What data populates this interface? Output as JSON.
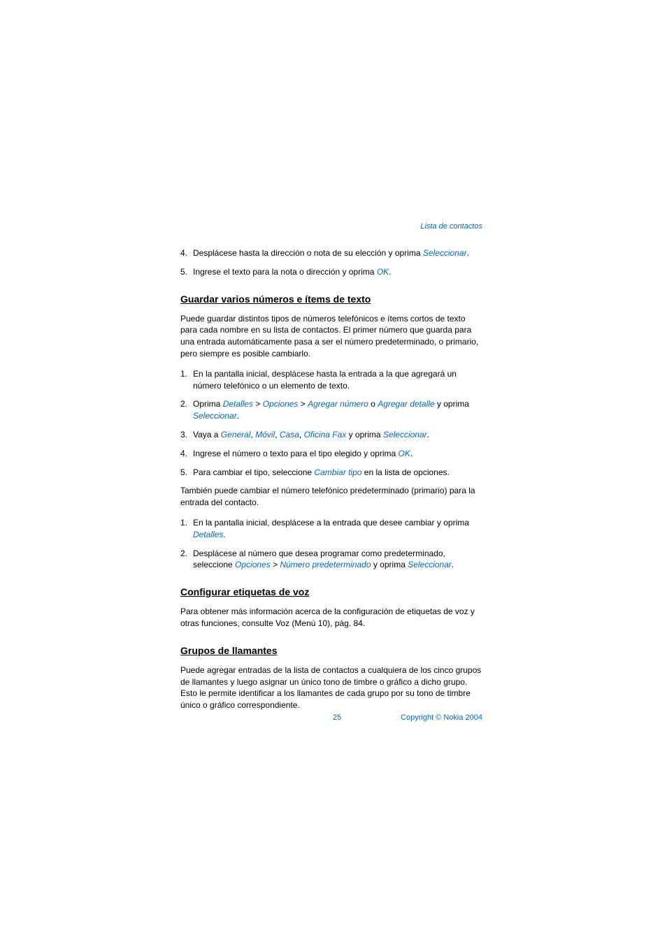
{
  "header": {
    "section_label": "Lista de contactos"
  },
  "list1": {
    "item4": {
      "num": "4.",
      "prefix": "Desplácese hasta la dirección o nota de su elección y oprima ",
      "link": "Seleccionar",
      "suffix": "."
    },
    "item5": {
      "num": "5.",
      "prefix": "Ingrese el texto para la nota o dirección y oprima ",
      "link": "OK",
      "suffix": "."
    }
  },
  "section1": {
    "heading": "Guardar varios números e ítems de texto",
    "intro": "Puede guardar distintos tipos de números telefónicos e ítems cortos de texto para cada nombre en su lista de contactos. El primer número que guarda para una entrada automáticamente pasa a ser el número predeterminado, o primario, pero siempre es posible cambiarlo.",
    "item1": {
      "num": "1.",
      "text": "En la pantalla inicial, desplácese hasta la entrada a la que agregará un número telefónico o un elemento de texto."
    },
    "item2": {
      "num": "2.",
      "t1": "Oprima ",
      "l1": "Detalles",
      "t2": " > ",
      "l2": "Opciones",
      "t3": " > ",
      "l3": "Agregar número",
      "t4": " o ",
      "l4": "Agregar detalle",
      "t5": " y oprima ",
      "l5": "Seleccionar",
      "t6": "."
    },
    "item3": {
      "num": "3.",
      "t1": "Vaya a ",
      "l1": "General",
      "t2": ",  ",
      "l2": "Móvil",
      "t3": ", ",
      "l3": "Casa",
      "t4": ", ",
      "l4": "Oficina Fax",
      "t5": " y oprima ",
      "l5": "Seleccionar",
      "t6": "."
    },
    "item4": {
      "num": "4.",
      "t1": "Ingrese el número o texto para el tipo elegido y oprima ",
      "l1": "OK",
      "t2": "."
    },
    "item5": {
      "num": "5.",
      "t1": "Para cambiar el tipo, seleccione ",
      "l1": "Cambiar tipo",
      "t2": " en la lista de opciones."
    },
    "para2": "También puede cambiar el número telefónico predeterminado (primario) para la entrada del contacto.",
    "item2_1": {
      "num": "1.",
      "t1": "En la pantalla inicial, desplácese a la entrada que desee cambiar y oprima ",
      "l1": "Detalles",
      "t2": "."
    },
    "item2_2": {
      "num": "2.",
      "t1": "Desplácese al número que desea programar como predeterminado, seleccione ",
      "l1": "Opciones",
      "t2": " > ",
      "l2": "Número predeterminado",
      "t3": " y oprima ",
      "l3": "Seleccionar",
      "t4": "."
    }
  },
  "section2": {
    "heading": "Configurar etiquetas de voz",
    "text": "Para obtener más información acerca de la configuración de etiquetas de voz y otras funciones, consulte Voz (Menú 10), pág. 84."
  },
  "section3": {
    "heading": "Grupos de llamantes",
    "text": "Puede agregar entradas de la lista de contactos a cualquiera de los cinco grupos de llamantes y luego asignar un único tono de timbre o gráfico a dicho grupo. Esto le permite identificar a los llamantes de cada grupo por su tono de timbre único o gráfico correspondiente."
  },
  "footer": {
    "page_num": "25",
    "copyright": "Copyright © Nokia 2004"
  }
}
